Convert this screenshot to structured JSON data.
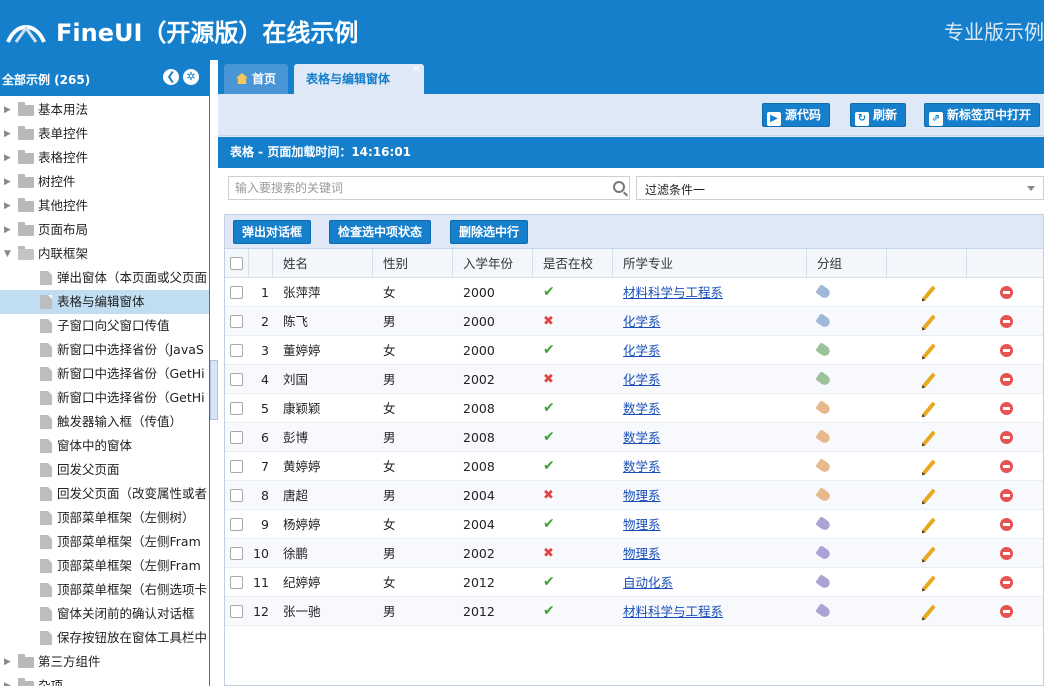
{
  "app": {
    "title": "FineUI（开源版）在线示例",
    "pro_link": "专业版示例"
  },
  "sidebar": {
    "title": "全部示例 (265)",
    "items": [
      {
        "label": "基本用法",
        "type": "folder"
      },
      {
        "label": "表单控件",
        "type": "folder"
      },
      {
        "label": "表格控件",
        "type": "folder"
      },
      {
        "label": "树控件",
        "type": "folder"
      },
      {
        "label": "其他控件",
        "type": "folder"
      },
      {
        "label": "页面布局",
        "type": "folder"
      },
      {
        "label": "内联框架",
        "type": "folder-open"
      },
      {
        "label": "弹出窗体（本页面或父页面",
        "type": "leaf"
      },
      {
        "label": "表格与编辑窗体",
        "type": "leaf",
        "selected": true
      },
      {
        "label": "子窗口向父窗口传值",
        "type": "leaf"
      },
      {
        "label": "新窗口中选择省份（JavaS",
        "type": "leaf"
      },
      {
        "label": "新窗口中选择省份（GetHi",
        "type": "leaf"
      },
      {
        "label": "新窗口中选择省份（GetHi",
        "type": "leaf"
      },
      {
        "label": "触发器输入框（传值）",
        "type": "leaf"
      },
      {
        "label": "窗体中的窗体",
        "type": "leaf"
      },
      {
        "label": "回发父页面",
        "type": "leaf"
      },
      {
        "label": "回发父页面（改变属性或者",
        "type": "leaf"
      },
      {
        "label": "顶部菜单框架（左侧树）",
        "type": "leaf"
      },
      {
        "label": "顶部菜单框架（左侧Fram",
        "type": "leaf"
      },
      {
        "label": "顶部菜单框架（左侧Fram",
        "type": "leaf"
      },
      {
        "label": "顶部菜单框架（右侧选项卡",
        "type": "leaf"
      },
      {
        "label": "窗体关闭前的确认对话框",
        "type": "leaf"
      },
      {
        "label": "保存按钮放在窗体工具栏中",
        "type": "leaf"
      },
      {
        "label": "第三方组件",
        "type": "folder"
      },
      {
        "label": "杂项",
        "type": "folder"
      }
    ]
  },
  "tabs": {
    "home": "首页",
    "active": "表格与编辑窗体",
    "close": "×"
  },
  "toolbar": {
    "source": "源代码",
    "refresh": "刷新",
    "open_new_tab": "新标签页中打开"
  },
  "panel": {
    "title": "表格 - 页面加载时间：14:16:01"
  },
  "search": {
    "placeholder": "输入要搜索的关键词",
    "filter_value": "过滤条件一"
  },
  "grid": {
    "buttons": {
      "popup": "弹出对话框",
      "check": "检查选中项状态",
      "delete": "删除选中行"
    },
    "columns": [
      "姓名",
      "性别",
      "入学年份",
      "是否在校",
      "所学专业",
      "分组"
    ],
    "rows": [
      {
        "no": "1",
        "name": "张萍萍",
        "gender": "女",
        "year": "2000",
        "at_school": true,
        "major": "材料科学与工程系",
        "tag_color": "#9fb8d8"
      },
      {
        "no": "2",
        "name": "陈飞",
        "gender": "男",
        "year": "2000",
        "at_school": false,
        "major": "化学系",
        "tag_color": "#9fb8d8"
      },
      {
        "no": "3",
        "name": "董婷婷",
        "gender": "女",
        "year": "2000",
        "at_school": true,
        "major": "化学系",
        "tag_color": "#9cc29a"
      },
      {
        "no": "4",
        "name": "刘国",
        "gender": "男",
        "year": "2002",
        "at_school": false,
        "major": "化学系",
        "tag_color": "#9cc29a"
      },
      {
        "no": "5",
        "name": "康颖颖",
        "gender": "女",
        "year": "2008",
        "at_school": true,
        "major": "数学系",
        "tag_color": "#e8b98a"
      },
      {
        "no": "6",
        "name": "彭博",
        "gender": "男",
        "year": "2008",
        "at_school": true,
        "major": "数学系",
        "tag_color": "#e8b98a"
      },
      {
        "no": "7",
        "name": "黄婷婷",
        "gender": "女",
        "year": "2008",
        "at_school": true,
        "major": "数学系",
        "tag_color": "#e8b98a"
      },
      {
        "no": "8",
        "name": "唐超",
        "gender": "男",
        "year": "2004",
        "at_school": false,
        "major": "物理系",
        "tag_color": "#e8b98a"
      },
      {
        "no": "9",
        "name": "杨婷婷",
        "gender": "女",
        "year": "2004",
        "at_school": true,
        "major": "物理系",
        "tag_color": "#a9a3d6"
      },
      {
        "no": "10",
        "name": "徐鹏",
        "gender": "男",
        "year": "2002",
        "at_school": false,
        "major": "物理系",
        "tag_color": "#a9a3d6"
      },
      {
        "no": "11",
        "name": "纪婷婷",
        "gender": "女",
        "year": "2012",
        "at_school": true,
        "major": "自动化系",
        "tag_color": "#a9a3d6"
      },
      {
        "no": "12",
        "name": "张一驰",
        "gender": "男",
        "year": "2012",
        "at_school": true,
        "major": "材料科学与工程系",
        "tag_color": "#a9a3d6"
      }
    ]
  },
  "colors": {
    "brand": "#157fcc",
    "tab_bg": "#dfe8f6",
    "selected": "#c1ddf1",
    "ok": "#3fa33c",
    "no": "#e04646"
  }
}
